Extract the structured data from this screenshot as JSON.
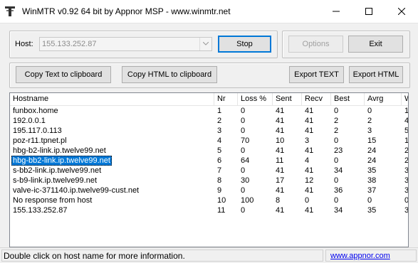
{
  "window": {
    "title": "WinMTR v0.92 64 bit by Appnor MSP - www.winmtr.net"
  },
  "host": {
    "label": "Host:",
    "value": "155.133.252.87"
  },
  "buttons": {
    "stop": "Stop",
    "options": "Options",
    "exit": "Exit",
    "copy_text": "Copy Text to clipboard",
    "copy_html": "Copy HTML to clipboard",
    "export_text": "Export TEXT",
    "export_html": "Export HTML"
  },
  "table": {
    "headers": [
      "Hostname",
      "Nr",
      "Loss %",
      "Sent",
      "Recv",
      "Best",
      "Avrg",
      "Wrst"
    ],
    "rows": [
      {
        "host": "funbox.home",
        "nr": "1",
        "loss": "0",
        "sent": "41",
        "recv": "41",
        "best": "0",
        "avrg": "0",
        "wrst": "1"
      },
      {
        "host": "192.0.0.1",
        "nr": "2",
        "loss": "0",
        "sent": "41",
        "recv": "41",
        "best": "2",
        "avrg": "2",
        "wrst": "4"
      },
      {
        "host": "195.117.0.113",
        "nr": "3",
        "loss": "0",
        "sent": "41",
        "recv": "41",
        "best": "2",
        "avrg": "3",
        "wrst": "5"
      },
      {
        "host": "poz-r11.tpnet.pl",
        "nr": "4",
        "loss": "70",
        "sent": "10",
        "recv": "3",
        "best": "0",
        "avrg": "15",
        "wrst": "1"
      },
      {
        "host": "hbg-b2-link.ip.twelve99.net",
        "nr": "5",
        "loss": "0",
        "sent": "41",
        "recv": "41",
        "best": "23",
        "avrg": "24",
        "wrst": "2"
      },
      {
        "host": "hbg-bb2-link.ip.twelve99.net",
        "nr": "6",
        "loss": "64",
        "sent": "11",
        "recv": "4",
        "best": "0",
        "avrg": "24",
        "wrst": "2"
      },
      {
        "host": "s-bb2-link.ip.twelve99.net",
        "nr": "7",
        "loss": "0",
        "sent": "41",
        "recv": "41",
        "best": "34",
        "avrg": "35",
        "wrst": "3"
      },
      {
        "host": "s-b9-link.ip.twelve99.net",
        "nr": "8",
        "loss": "30",
        "sent": "17",
        "recv": "12",
        "best": "0",
        "avrg": "38",
        "wrst": "3"
      },
      {
        "host": "valve-ic-371140.ip.twelve99-cust.net",
        "nr": "9",
        "loss": "0",
        "sent": "41",
        "recv": "41",
        "best": "36",
        "avrg": "37",
        "wrst": "3"
      },
      {
        "host": "No response from host",
        "nr": "10",
        "loss": "100",
        "sent": "8",
        "recv": "0",
        "best": "0",
        "avrg": "0",
        "wrst": "0"
      },
      {
        "host": "155.133.252.87",
        "nr": "11",
        "loss": "0",
        "sent": "41",
        "recv": "41",
        "best": "34",
        "avrg": "35",
        "wrst": "3"
      }
    ],
    "selected_row": 5
  },
  "status": {
    "message": "Double click on host name for more information.",
    "link": "www.appnor.com"
  },
  "colors": {
    "selection": "#0078d7",
    "default_button_border": "#0078d7",
    "link": "#0000ee"
  }
}
